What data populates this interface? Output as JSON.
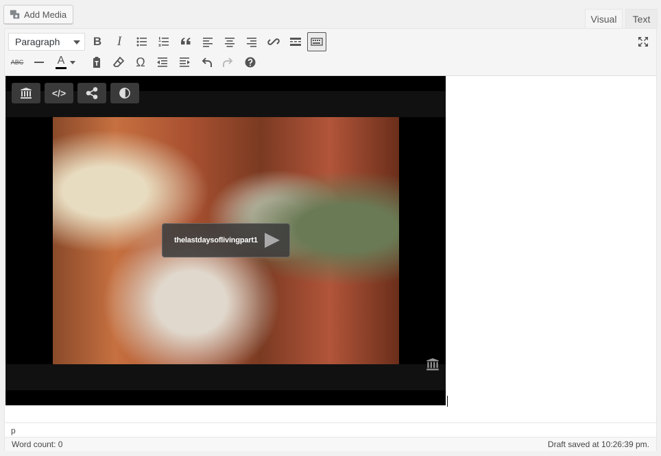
{
  "add_media": {
    "label": "Add Media"
  },
  "tabs": [
    {
      "label": "Visual",
      "active": true
    },
    {
      "label": "Text",
      "active": false
    }
  ],
  "toolbar": {
    "format_select": "Paragraph",
    "row1": [
      "bold-icon",
      "italic-icon",
      "bulleted-list-icon",
      "numbered-list-icon",
      "blockquote-icon",
      "align-left-icon",
      "align-center-icon",
      "align-right-icon",
      "link-icon",
      "read-more-icon",
      "toolbar-toggle-icon"
    ],
    "row2": [
      "strikethrough-icon",
      "horizontal-line-icon",
      "text-color-icon",
      "paste-as-text-icon",
      "clear-formatting-icon",
      "special-character-icon",
      "outdent-icon",
      "indent-icon",
      "undo-icon",
      "redo-icon",
      "help-icon"
    ],
    "strike_label": "ABC",
    "text_color_label": "A",
    "text_color": "#000000",
    "bold_label": "B",
    "italic_label": "I",
    "omega_label": "Ω"
  },
  "video": {
    "title": "thelastdaysoflivingpart1",
    "controls": [
      "archive-icon",
      "embed-code-icon",
      "share-icon",
      "theater-mode-icon"
    ],
    "embed_label": "</>"
  },
  "path": "p",
  "status": {
    "word_count": "Word count: 0",
    "draft_saved": "Draft saved at 10:26:39 pm."
  },
  "colors": {
    "accent": "#555555",
    "toolbar_bg": "#f5f5f5",
    "video_bg": "#000000"
  }
}
